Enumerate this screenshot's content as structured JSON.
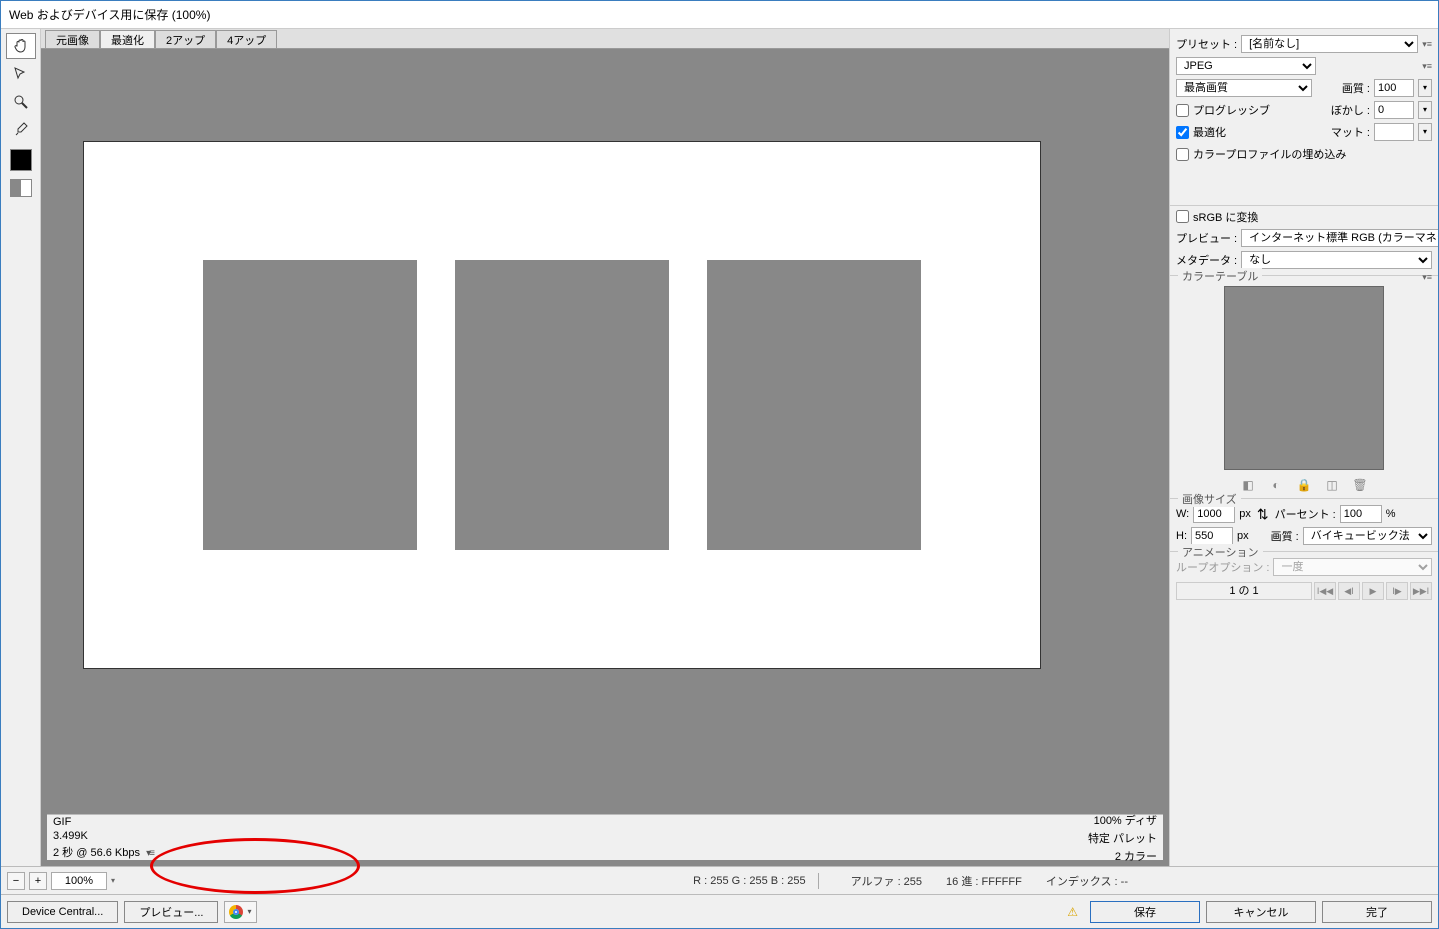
{
  "window": {
    "title": "Web およびデバイス用に保存 (100%)"
  },
  "tabs": {
    "items": [
      "元画像",
      "最適化",
      "2アップ",
      "4アップ"
    ]
  },
  "canvas_info": {
    "format": "GIF",
    "size": "3.499K",
    "time": "2 秒 @ 56.6 Kbps",
    "dither": "100% ディザ",
    "palette": "特定 パレット",
    "colors": "2 カラー"
  },
  "right": {
    "preset_label": "プリセット :",
    "preset_value": "[名前なし]",
    "format": "JPEG",
    "quality_select": "最高画質",
    "quality_label": "画質 :",
    "quality_value": "100",
    "progressive_label": "プログレッシブ",
    "blur_label": "ぼかし :",
    "blur_value": "0",
    "optimized_label": "最適化",
    "matte_label": "マット :",
    "embed_profile_label": "カラープロファイルの埋め込み",
    "srgb_label": "sRGB に変換",
    "preview_label": "プレビュー :",
    "preview_value": "インターネット標準 RGB (カラーマネジメ...",
    "metadata_label": "メタデータ :",
    "metadata_value": "なし",
    "colortable_title": "カラーテーブル",
    "imagesize_title": "画像サイズ",
    "w_label": "W:",
    "w_value": "1000",
    "h_label": "H:",
    "h_value": "550",
    "px": "px",
    "percent_label": "パーセント :",
    "percent_value": "100",
    "percent_suffix": "%",
    "resample_label": "画質 :",
    "resample_value": "バイキュービック法",
    "anim_title": "アニメーション",
    "loop_label": "ループオプション :",
    "loop_value": "一度",
    "anim_page": "1 の 1"
  },
  "status": {
    "zoom": "100%",
    "rgb": "R : 255    G : 255    B : 255",
    "alpha": "アルファ : 255",
    "hex": "16 進 : FFFFFF",
    "index": "インデックス : --"
  },
  "buttons": {
    "device_central": "Device Central...",
    "preview": "プレビュー...",
    "save": "保存",
    "cancel": "キャンセル",
    "done": "完了"
  }
}
